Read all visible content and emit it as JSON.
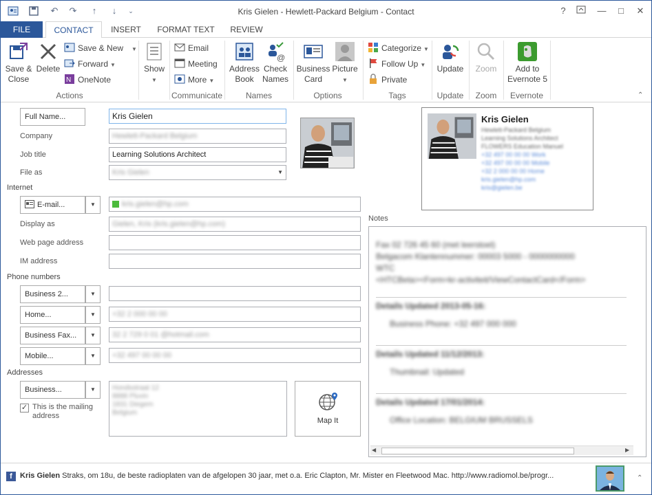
{
  "window": {
    "title": "Kris Gielen - Hewlett-Packard Belgium - Contact",
    "controls": {
      "help": "?",
      "restore": "⧉",
      "minimize": "—",
      "maximize": "□",
      "close": "✕"
    }
  },
  "tabs": [
    "FILE",
    "CONTACT",
    "INSERT",
    "FORMAT TEXT",
    "REVIEW"
  ],
  "ribbon": {
    "actions": {
      "save_close": [
        "Save &",
        "Close"
      ],
      "delete": "Delete",
      "save_new": "Save & New",
      "forward": "Forward",
      "onenote": "OneNote",
      "label": "Actions"
    },
    "show": {
      "label": "Show"
    },
    "communicate": {
      "email": "Email",
      "meeting": "Meeting",
      "more": "More",
      "label": "Communicate"
    },
    "names": {
      "address_book": [
        "Address",
        "Book"
      ],
      "check_names": [
        "Check",
        "Names"
      ],
      "label": "Names"
    },
    "options": {
      "business_card": [
        "Business",
        "Card"
      ],
      "picture": "Picture",
      "label": "Options"
    },
    "tags": {
      "categorize": "Categorize",
      "follow_up": "Follow Up",
      "private": "Private",
      "label": "Tags"
    },
    "update": {
      "update": "Update",
      "label": "Update"
    },
    "zoom": {
      "zoom": "Zoom",
      "label": "Zoom"
    },
    "evernote": {
      "add": [
        "Add to",
        "Evernote 5"
      ],
      "label": "Evernote"
    }
  },
  "form": {
    "full_name_btn": "Full Name...",
    "full_name": "Kris Gielen",
    "company_label": "Company",
    "company": "Hewlett-Packard Belgium",
    "job_title_label": "Job title",
    "job_title": "Learning Solutions Architect",
    "file_as_label": "File as",
    "file_as": "Kris Gielen",
    "internet_label": "Internet",
    "email_btn": "E-mail...",
    "email": "kris.gielen@hp.com",
    "display_as_label": "Display as",
    "display_as": "Gielen, Kris (kris.gielen@hp.com)",
    "web_label": "Web page address",
    "web": "",
    "im_label": "IM address",
    "im": "",
    "phone_label": "Phone numbers",
    "phones": [
      {
        "btn": "Business 2...",
        "value": ""
      },
      {
        "btn": "Home...",
        "value": "+32 2 000 00 00"
      },
      {
        "btn": "Business Fax...",
        "value": "32 2 729 0 01 @hotmail.com"
      },
      {
        "btn": "Mobile...",
        "value": "+32 497 00 00 00"
      }
    ],
    "addresses_label": "Addresses",
    "address_btn": "Business...",
    "address_lines": [
      "Hondsstraat 12",
      "8888 Pluvin",
      "1831 Diegem",
      "Belgium"
    ],
    "mailing_checkbox": "This is the mailing address",
    "map_it": "Map It"
  },
  "card": {
    "name": "Kris Gielen",
    "lines": [
      "Hewlett-Packard Belgium",
      "Learning Solutions Architect",
      "FLOWERS Education Manuel",
      "+32 497 00 00 00 Work",
      "+32 497 00 00 00 Mobile",
      "+32 2 000 00 00 Home",
      "kris.gielen@hp.com",
      "kris@gielen.be"
    ]
  },
  "notes": {
    "label": "Notes",
    "lines": [
      "Fax 02 726 45 60 (met leerstoel)",
      "Belgacom Klantennummer: 00003 5000 - 0000000000",
      "WTC",
      "<HTCBeta><Form=kr-activiteit/ViewContactCard</Form>",
      "Details Updated 2013-05-16:",
      "Business Phone: +32 497 000 000",
      "Details Updated 11/12/2013:",
      "Thumbnail: Updated",
      "Details Updated 17/01/2014:",
      "Office Location: BELGIUM BRUSSELS"
    ]
  },
  "social": {
    "name": "Kris Gielen",
    "status": "Straks, om 18u, de beste radioplaten van de afgelopen 30 jaar, met o.a. Eric Clapton, Mr. Mister en Fleetwood Mac. http://www.radiomol.be/progr..."
  }
}
